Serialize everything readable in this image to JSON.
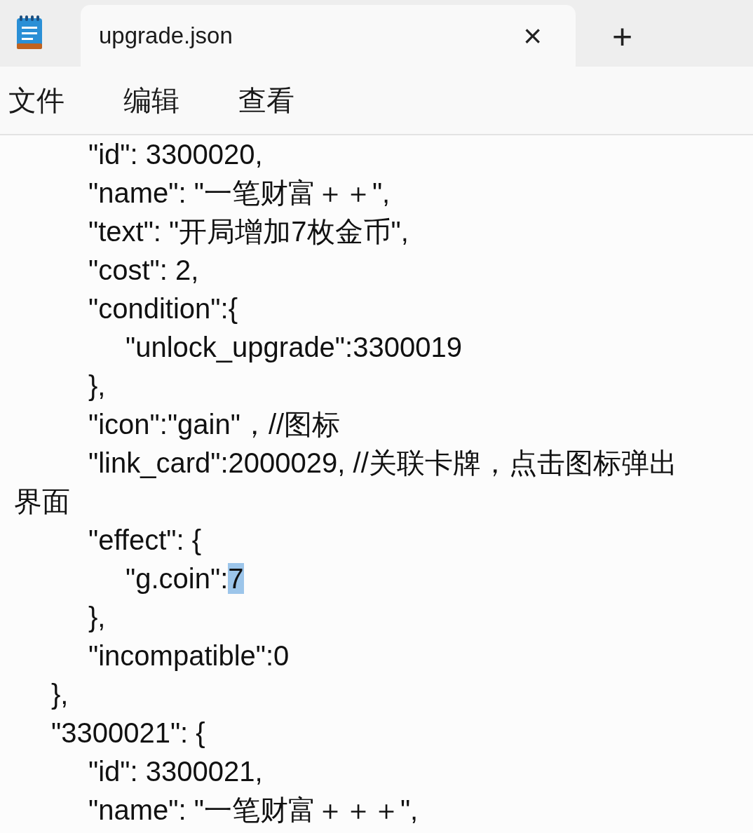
{
  "tabs": [
    {
      "title": "upgrade.json",
      "selected": true,
      "close": "×"
    }
  ],
  "new_tab": "+",
  "menu": [
    {
      "label": "文件"
    },
    {
      "label": "编辑"
    },
    {
      "label": "查看"
    }
  ],
  "editor": {
    "lines": [
      {
        "text": "\t\t\"id\": 3300020,"
      },
      {
        "text": "\t\t\"name\": \"一笔财富＋＋\","
      },
      {
        "text": "\t\t\"text\": \"开局增加7枚金币\","
      },
      {
        "text": "\t\t\"cost\": 2,"
      },
      {
        "text": "\t\t\"condition\":{"
      },
      {
        "text": "\t\t\t\"unlock_upgrade\":3300019"
      },
      {
        "text": "\t\t},"
      },
      {
        "text": "\t\t\"icon\":\"gain\"，//图标"
      },
      {
        "text": "\t\t\"link_card\":2000029, //关联卡牌，点击图标弹出"
      },
      {
        "text": "界面"
      },
      {
        "text": "\t\t\"effect\": {"
      },
      {
        "text": "\t\t\t\"g.coin\":",
        "selected_text": "7"
      },
      {
        "text": "\t\t},"
      },
      {
        "text": "\t\t\"incompatible\":0"
      },
      {
        "text": "\t},"
      },
      {
        "text": "\t\"3300021\": {"
      },
      {
        "text": "\t\t\"id\": 3300021,"
      },
      {
        "text": "\t\t\"name\": \"一笔财富＋＋＋\","
      }
    ]
  }
}
